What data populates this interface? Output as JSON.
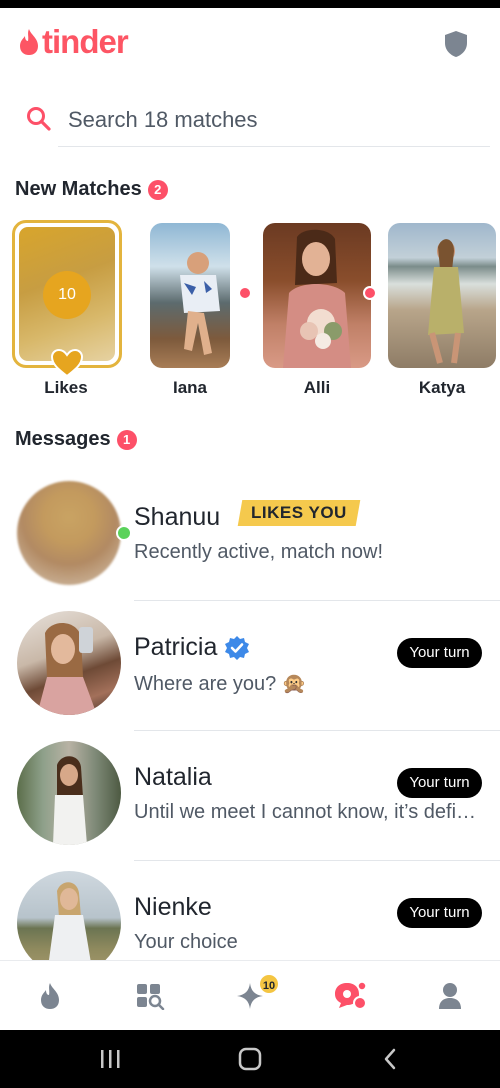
{
  "app": {
    "logo_text": "tinder",
    "brand_color": "#fd5564"
  },
  "header": {
    "shield_icon": "shield-icon"
  },
  "search": {
    "placeholder": "Search 18 matches"
  },
  "new_matches": {
    "title": "New Matches",
    "count": "2",
    "likes_card": {
      "label": "Likes",
      "count": "10"
    },
    "items": [
      {
        "name": "Iana",
        "online": true
      },
      {
        "name": "Alli",
        "online": true
      },
      {
        "name": "Katya",
        "online": false
      }
    ]
  },
  "messages": {
    "title": "Messages",
    "count": "1",
    "items": [
      {
        "name": "Shanuu",
        "tag": "LIKES YOU",
        "text": "Recently active, match now!",
        "active": true
      },
      {
        "name": "Patricia",
        "verified": true,
        "text": "Where are you? 🙊",
        "badge": "Your turn"
      },
      {
        "name": "Natalia",
        "text": "Until we meet I cannot know, it’s definitely not a good idea",
        "badge": "Your turn"
      },
      {
        "name": "Nienke",
        "text": "Your choice",
        "badge": "Your turn"
      }
    ]
  },
  "navbar": {
    "items": [
      "flame-icon",
      "explore-icon",
      "spark-icon",
      "chat-icon",
      "profile-icon"
    ],
    "spark_badge": "10",
    "active_color": "#fd5068"
  },
  "system_nav": [
    "recent-apps-icon",
    "home-icon",
    "back-icon"
  ]
}
